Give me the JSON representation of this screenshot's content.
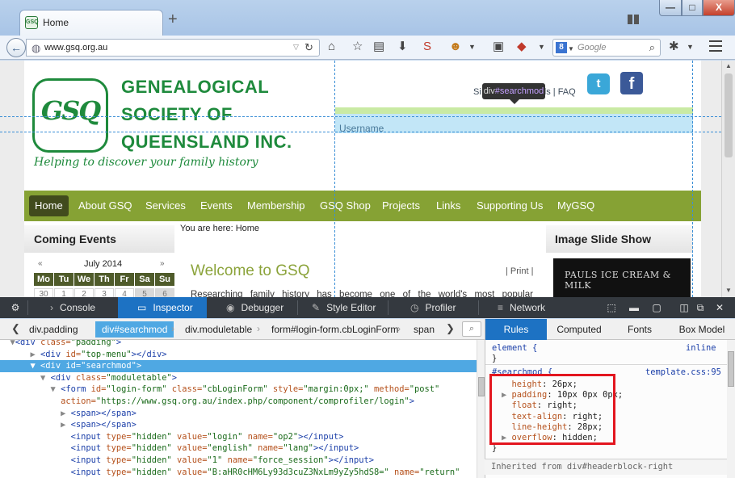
{
  "browser": {
    "tab_title": "Home",
    "new_tab_symbol": "+",
    "url": "www.gsq.org.au",
    "search_placeholder": "Google",
    "window_controls": {
      "minimize": "—",
      "maximize": "□",
      "close": "X"
    }
  },
  "site": {
    "logo_letters": "GSQ",
    "name_lines": [
      "GENEALOGICAL",
      "SOCIETY OF",
      "QUEENSLAND INC."
    ],
    "tagline": "Helping to discover your family history",
    "top_links": "Si",
    "top_links_tail": "ls | FAQ",
    "twitter_glyph": "t",
    "facebook_glyph": "f",
    "tooltip": {
      "tag": "div",
      "id": "#searchmod"
    },
    "username_label": "Username",
    "menu": [
      "Home",
      "About GSQ",
      "Services",
      "Events",
      "Membership",
      "GSQ Shop",
      "Projects",
      "Links",
      "Supporting Us",
      "MyGSQ"
    ],
    "left_heading": "Coming Events",
    "breadcrumb": "You are here: Home",
    "calendar": {
      "prev": "«",
      "next": "»",
      "month": "July 2014",
      "days": [
        "Mo",
        "Tu",
        "We",
        "Th",
        "Fr",
        "Sa",
        "Su"
      ],
      "first_row": [
        "30",
        "1",
        "2",
        "3",
        "4",
        "5",
        "6"
      ]
    },
    "main_title": "Welcome to GSQ",
    "print_link": "| Print |",
    "intro": "Researching family history has become one of the world's most popular pastimes. The",
    "right_heading": "Image Slide Show",
    "slide_text": "PAULS ICE CREAM & MILK"
  },
  "devtools": {
    "tabs": [
      {
        "label": "Console",
        "icon": "›"
      },
      {
        "label": "Inspector",
        "icon": "▭"
      },
      {
        "label": "Debugger",
        "icon": "◉"
      },
      {
        "label": "Style Editor",
        "icon": "✎"
      },
      {
        "label": "Profiler",
        "icon": "◷"
      },
      {
        "label": "Network",
        "icon": "≡"
      }
    ],
    "breadcrumbs": [
      "div.padding",
      "div#searchmod",
      "div.moduletable",
      "form#login-form.cbLoginForm",
      "span"
    ],
    "side_tabs": [
      "Rules",
      "Computed",
      "Fonts",
      "Box Model"
    ],
    "markup": [
      {
        "t": "<div class=\"padding\">",
        "parts": [
          [
            "tw",
            "  ▼"
          ],
          [
            "tn",
            "<div"
          ],
          [
            "an",
            " class="
          ],
          [
            "av",
            "\"padding\""
          ],
          [
            "tn",
            ">"
          ]
        ]
      },
      {
        "parts": [
          [
            "tw",
            "      ▶ "
          ],
          [
            "tn",
            "<div"
          ],
          [
            "an",
            " id="
          ],
          [
            "av",
            "\"top-menu\""
          ],
          [
            "tn",
            "></div>"
          ]
        ]
      },
      {
        "parts": [
          [
            "tw",
            "      ▼ "
          ],
          [
            "tn",
            "<div"
          ],
          [
            "an",
            " id="
          ],
          [
            "av",
            "\"searchmod\""
          ],
          [
            "tn",
            ">"
          ]
        ]
      },
      {
        "parts": [
          [
            "tw",
            "        ▼ "
          ],
          [
            "tn",
            "<div"
          ],
          [
            "an",
            " class="
          ],
          [
            "av",
            "\"moduletable\""
          ],
          [
            "tn",
            ">"
          ]
        ]
      },
      {
        "parts": [
          [
            "tw",
            "          ▼ "
          ],
          [
            "tn",
            "<form"
          ],
          [
            "an",
            " id="
          ],
          [
            "av",
            "\"login-form\""
          ],
          [
            "an",
            " class="
          ],
          [
            "av",
            "\"cbLoginForm\""
          ],
          [
            "an",
            " style="
          ],
          [
            "av",
            "\"margin:0px;\""
          ],
          [
            "an",
            " method="
          ],
          [
            "av",
            "\"post\""
          ]
        ]
      },
      {
        "parts": [
          [
            "an",
            "            action="
          ],
          [
            "av",
            "\"https://www.gsq.org.au/index.php/component/comprofiler/login\""
          ],
          [
            "tn",
            ">"
          ]
        ]
      },
      {
        "parts": [
          [
            "tw",
            "            ▶ "
          ],
          [
            "tn",
            "<span></span>"
          ]
        ]
      },
      {
        "parts": [
          [
            "tw",
            "            ▶ "
          ],
          [
            "tn",
            "<span></span>"
          ]
        ]
      },
      {
        "parts": [
          [
            "tw",
            "              "
          ],
          [
            "tn",
            "<input"
          ],
          [
            "an",
            " type="
          ],
          [
            "av",
            "\"hidden\""
          ],
          [
            "an",
            " value="
          ],
          [
            "av",
            "\"login\""
          ],
          [
            "an",
            " name="
          ],
          [
            "av",
            "\"op2\""
          ],
          [
            "tn",
            "></input>"
          ]
        ]
      },
      {
        "parts": [
          [
            "tw",
            "              "
          ],
          [
            "tn",
            "<input"
          ],
          [
            "an",
            " type="
          ],
          [
            "av",
            "\"hidden\""
          ],
          [
            "an",
            " value="
          ],
          [
            "av",
            "\"english\""
          ],
          [
            "an",
            " name="
          ],
          [
            "av",
            "\"lang\""
          ],
          [
            "tn",
            "></input>"
          ]
        ]
      },
      {
        "parts": [
          [
            "tw",
            "              "
          ],
          [
            "tn",
            "<input"
          ],
          [
            "an",
            " type="
          ],
          [
            "av",
            "\"hidden\""
          ],
          [
            "an",
            " value="
          ],
          [
            "av",
            "\"1\""
          ],
          [
            "an",
            " name="
          ],
          [
            "av",
            "\"force_session\""
          ],
          [
            "tn",
            "></input>"
          ]
        ]
      },
      {
        "parts": [
          [
            "tw",
            "              "
          ],
          [
            "tn",
            "<input"
          ],
          [
            "an",
            " type="
          ],
          [
            "av",
            "\"hidden\""
          ],
          [
            "an",
            " value="
          ],
          [
            "av",
            "\"B:aHR0cHM6Ly93d3cuZ3NxLm9yZy5hdS8=\""
          ],
          [
            "an",
            " name="
          ],
          [
            "av",
            "\"return\""
          ]
        ]
      }
    ],
    "rules": {
      "element_selector": "element {",
      "element_close": "}",
      "element_source": "inline",
      "searchmod_selector": "#searchmod {",
      "searchmod_source": "template.css:95",
      "properties": [
        {
          "name": "height",
          "value": "26px;",
          "expander": false
        },
        {
          "name": "padding",
          "value": "10px 0px 0px;",
          "expander": true
        },
        {
          "name": "float",
          "value": "right;",
          "expander": false
        },
        {
          "name": "text-align",
          "value": "right;",
          "expander": false
        },
        {
          "name": "line-height",
          "value": "28px;",
          "expander": false
        },
        {
          "name": "overflow",
          "value": "hidden;",
          "expander": true
        }
      ],
      "close": "}",
      "inherited": "Inherited from div#headerblock-right"
    }
  },
  "colors": {
    "site_green": "#1e8a3c",
    "menu_olive": "#86a234",
    "devtools_accent": "#1d72c3",
    "highlight_red": "#e3161f"
  }
}
